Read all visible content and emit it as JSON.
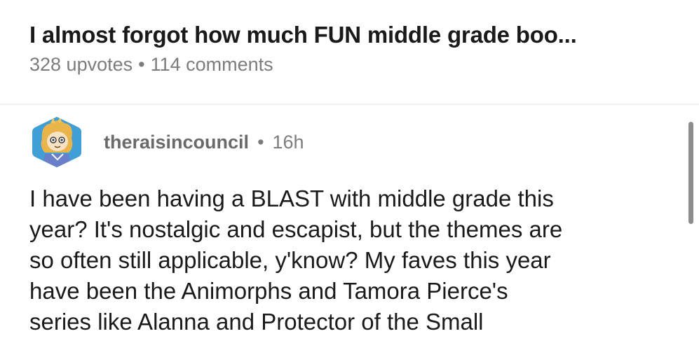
{
  "post": {
    "title": "I almost forgot how much FUN middle grade boo...",
    "upvotes": "328 upvotes",
    "separator": "•",
    "comments": "114 comments"
  },
  "comment": {
    "avatar_icon": "user-avatar-icon",
    "author": "theraisincouncil",
    "separator": "•",
    "age": "16h",
    "body": "I have been having a BLAST with middle grade this\nyear? It's nostalgic and escapist, but the themes are\nso often still applicable, y'know? My faves this year\nhave been the Animorphs and Tamora Pierce's\nseries like Alanna and Protector of the Small"
  },
  "colors": {
    "title_text": "#1a1a1b",
    "meta_text": "#7c7c7c",
    "author_text": "#6a6a6a",
    "avatar_bg": "#2a8cc7",
    "scrollbar": "#8d8d8d"
  }
}
